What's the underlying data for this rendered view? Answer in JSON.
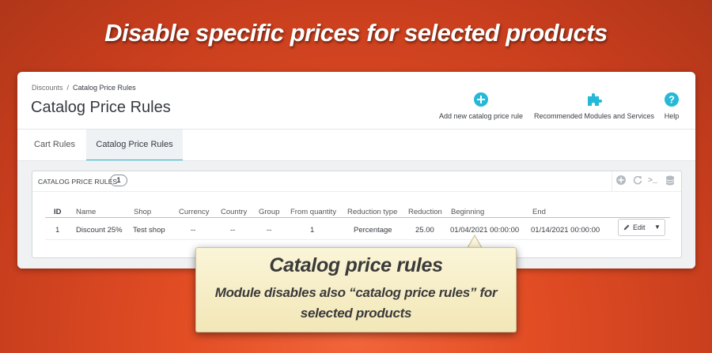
{
  "headline": "Disable specific prices for selected products",
  "breadcrumb": {
    "parent": "Discounts",
    "separator": "/",
    "current": "Catalog Price Rules"
  },
  "page_title": "Catalog Price Rules",
  "toolbar": {
    "add_label": "Add new catalog price rule",
    "modules_label": "Recommended Modules and Services",
    "help_label": "Help"
  },
  "tabs": [
    {
      "label": "Cart Rules",
      "active": false
    },
    {
      "label": "Catalog Price Rules",
      "active": true
    }
  ],
  "card": {
    "title": "CATALOG PRICE RULES",
    "count": "1",
    "actions": [
      "add-icon",
      "refresh-icon",
      "sql-query-icon",
      "export-database-icon"
    ]
  },
  "table": {
    "columns": [
      "ID",
      "Name",
      "Shop",
      "Currency",
      "Country",
      "Group",
      "From quantity",
      "Reduction type",
      "Reduction",
      "Beginning",
      "End"
    ],
    "rows": [
      {
        "cells": [
          "1",
          "Discount 25%",
          "Test shop",
          "--",
          "--",
          "--",
          "1",
          "Percentage",
          "25.00",
          "01/04/2021 00:00:00",
          "01/14/2021 00:00:00"
        ]
      }
    ],
    "edit_label": "Edit"
  },
  "tooltip": {
    "title": "Catalog price rules",
    "body": "Module disables also “catalog price rules” for selected products"
  },
  "colors": {
    "background": "#e24d24",
    "accent": "#25b9d7",
    "tooltip_bg": "#f6edc6",
    "text": "#363a41"
  }
}
